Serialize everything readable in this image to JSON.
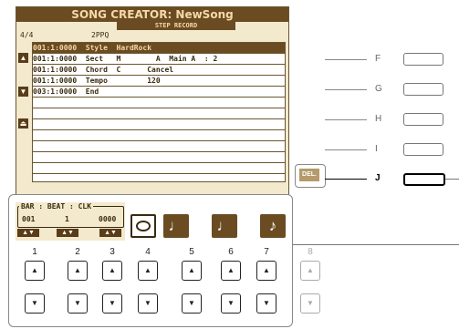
{
  "title": "SONG CREATOR: NewSong",
  "subtitle": "STEP RECORD",
  "header": {
    "measure": "4/4",
    "ppq": "2PPQ"
  },
  "rows": [
    {
      "text": "001:1:0000  Style  HardRock"
    },
    {
      "text": "001:1:0000  Sect   M        A  Main A  : 2"
    },
    {
      "text": "001:1:0000  Chord  C      Cancel"
    },
    {
      "text": "001:1:0000  Tempo         120"
    },
    {
      "text": "003:1:0000  End"
    }
  ],
  "right_labels": [
    "F",
    "G",
    "H",
    "I",
    "J"
  ],
  "del_label": "DEL.",
  "position": {
    "label": "BAR : BEAT : CLK",
    "bar": "001",
    "beat": "1",
    "clk": "0000"
  },
  "note_buttons": [
    "𝅝",
    "♩",
    "♩",
    "♪"
  ],
  "numbers": [
    "1",
    "2",
    "3",
    "4",
    "5",
    "6",
    "7",
    "8"
  ],
  "up_arrow": "▲",
  "down_arrow": "▼",
  "updown": "▲▼"
}
